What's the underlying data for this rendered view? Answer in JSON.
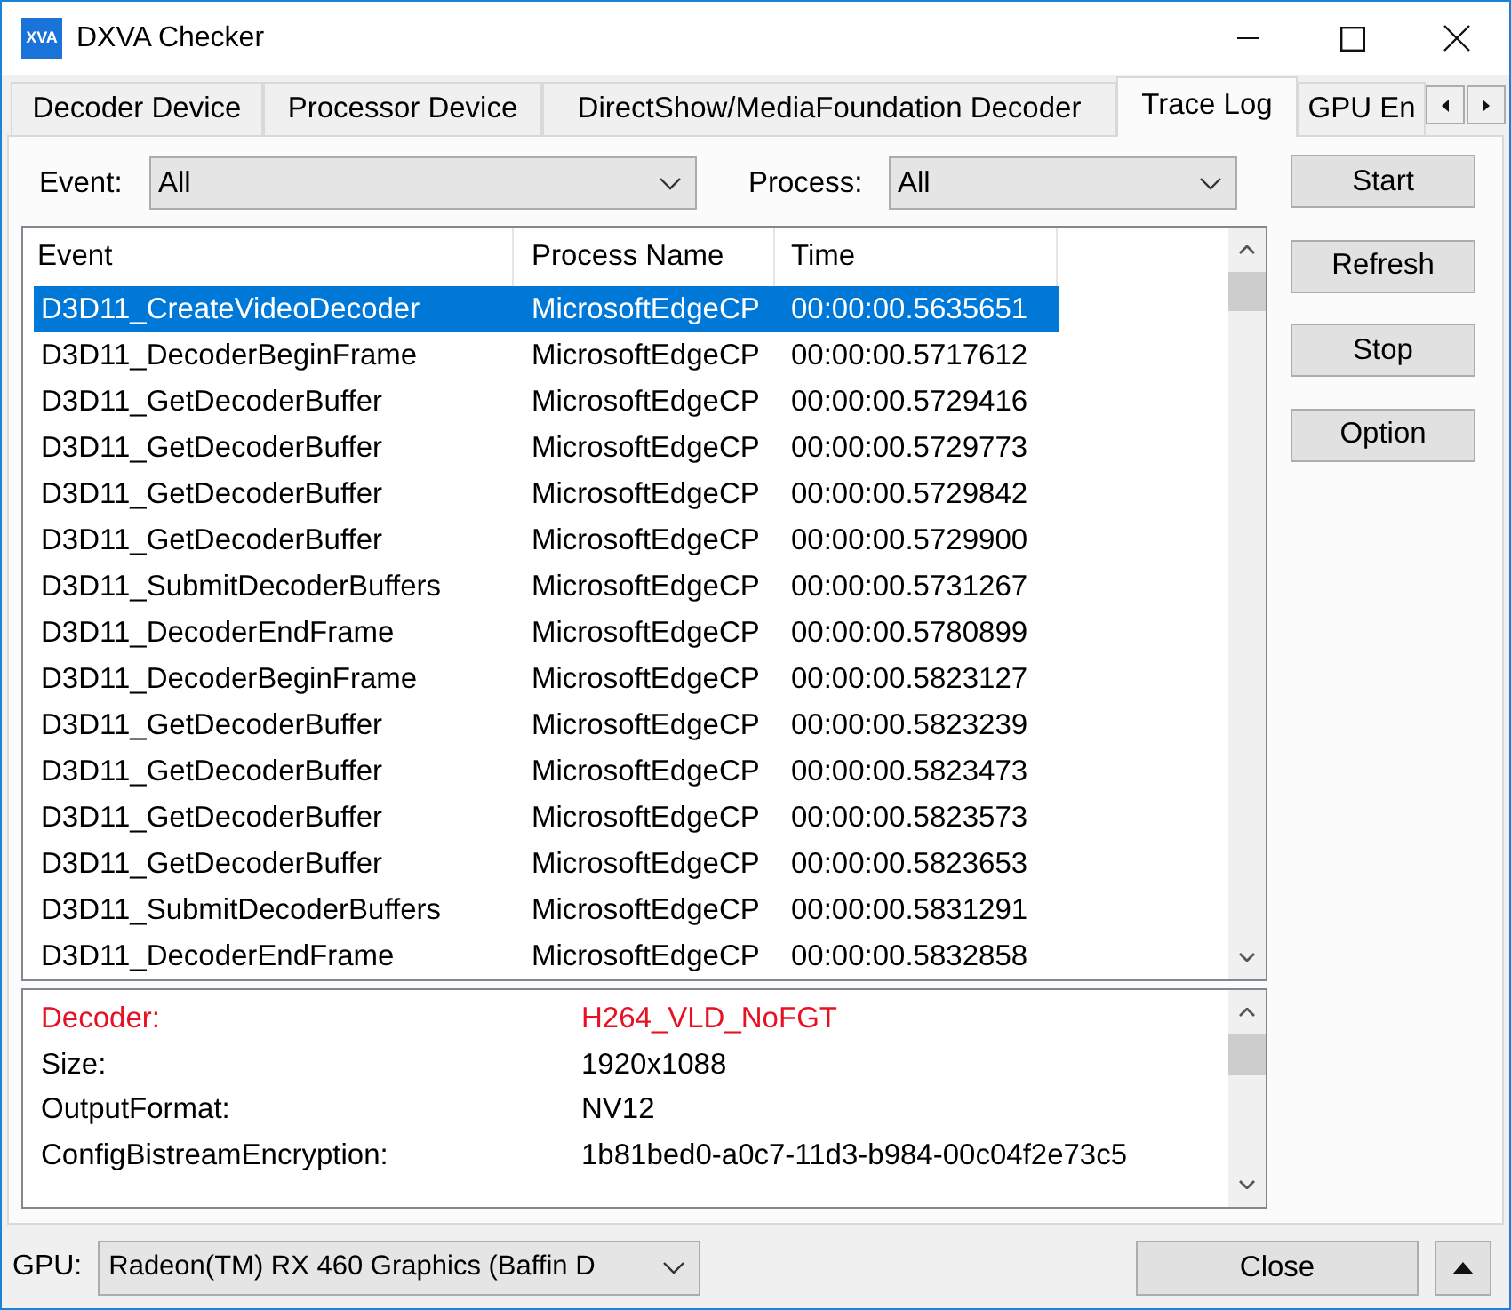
{
  "window": {
    "title": "DXVA Checker",
    "logo_text": "XVA"
  },
  "tabs": [
    {
      "label": "Decoder Device",
      "selected": false
    },
    {
      "label": "Processor Device",
      "selected": false
    },
    {
      "label": "DirectShow/MediaFoundation Decoder",
      "selected": false
    },
    {
      "label": "Trace Log",
      "selected": true
    },
    {
      "label": "GPU En",
      "selected": false
    }
  ],
  "filters": [
    {
      "label": "Event:",
      "value": "All"
    },
    {
      "label": "Process:",
      "value": "All"
    }
  ],
  "trace_table": {
    "columns": [
      "Event",
      "Process Name",
      "Time"
    ],
    "rows": [
      {
        "event": "D3D11_CreateVideoDecoder",
        "process": "MicrosoftEdgeCP",
        "time": "00:00:00.5635651",
        "selected": true
      },
      {
        "event": "D3D11_DecoderBeginFrame",
        "process": "MicrosoftEdgeCP",
        "time": "00:00:00.5717612",
        "selected": false
      },
      {
        "event": "D3D11_GetDecoderBuffer",
        "process": "MicrosoftEdgeCP",
        "time": "00:00:00.5729416",
        "selected": false
      },
      {
        "event": "D3D11_GetDecoderBuffer",
        "process": "MicrosoftEdgeCP",
        "time": "00:00:00.5729773",
        "selected": false
      },
      {
        "event": "D3D11_GetDecoderBuffer",
        "process": "MicrosoftEdgeCP",
        "time": "00:00:00.5729842",
        "selected": false
      },
      {
        "event": "D3D11_GetDecoderBuffer",
        "process": "MicrosoftEdgeCP",
        "time": "00:00:00.5729900",
        "selected": false
      },
      {
        "event": "D3D11_SubmitDecoderBuffers",
        "process": "MicrosoftEdgeCP",
        "time": "00:00:00.5731267",
        "selected": false
      },
      {
        "event": "D3D11_DecoderEndFrame",
        "process": "MicrosoftEdgeCP",
        "time": "00:00:00.5780899",
        "selected": false
      },
      {
        "event": "D3D11_DecoderBeginFrame",
        "process": "MicrosoftEdgeCP",
        "time": "00:00:00.5823127",
        "selected": false
      },
      {
        "event": "D3D11_GetDecoderBuffer",
        "process": "MicrosoftEdgeCP",
        "time": "00:00:00.5823239",
        "selected": false
      },
      {
        "event": "D3D11_GetDecoderBuffer",
        "process": "MicrosoftEdgeCP",
        "time": "00:00:00.5823473",
        "selected": false
      },
      {
        "event": "D3D11_GetDecoderBuffer",
        "process": "MicrosoftEdgeCP",
        "time": "00:00:00.5823573",
        "selected": false
      },
      {
        "event": "D3D11_GetDecoderBuffer",
        "process": "MicrosoftEdgeCP",
        "time": "00:00:00.5823653",
        "selected": false
      },
      {
        "event": "D3D11_SubmitDecoderBuffers",
        "process": "MicrosoftEdgeCP",
        "time": "00:00:00.5831291",
        "selected": false
      },
      {
        "event": "D3D11_DecoderEndFrame",
        "process": "MicrosoftEdgeCP",
        "time": "00:00:00.5832858",
        "selected": false
      }
    ]
  },
  "details": [
    {
      "label": "Decoder:",
      "value": "H264_VLD_NoFGT",
      "highlighted": true
    },
    {
      "label": "Size:",
      "value": "1920x1088",
      "highlighted": false
    },
    {
      "label": "OutputFormat:",
      "value": "NV12",
      "highlighted": false
    },
    {
      "label": "ConfigBistreamEncryption:",
      "value": "1b81bed0-a0c7-11d3-b984-00c04f2e73c5",
      "highlighted": false
    }
  ],
  "side_buttons": [
    {
      "label": "Start"
    },
    {
      "label": "Refresh"
    },
    {
      "label": "Stop"
    },
    {
      "label": "Option"
    }
  ],
  "gpu": {
    "label": "GPU:",
    "value": "Radeon(TM) RX 460 Graphics (Baffin D"
  },
  "close_button": {
    "label": "Close"
  }
}
